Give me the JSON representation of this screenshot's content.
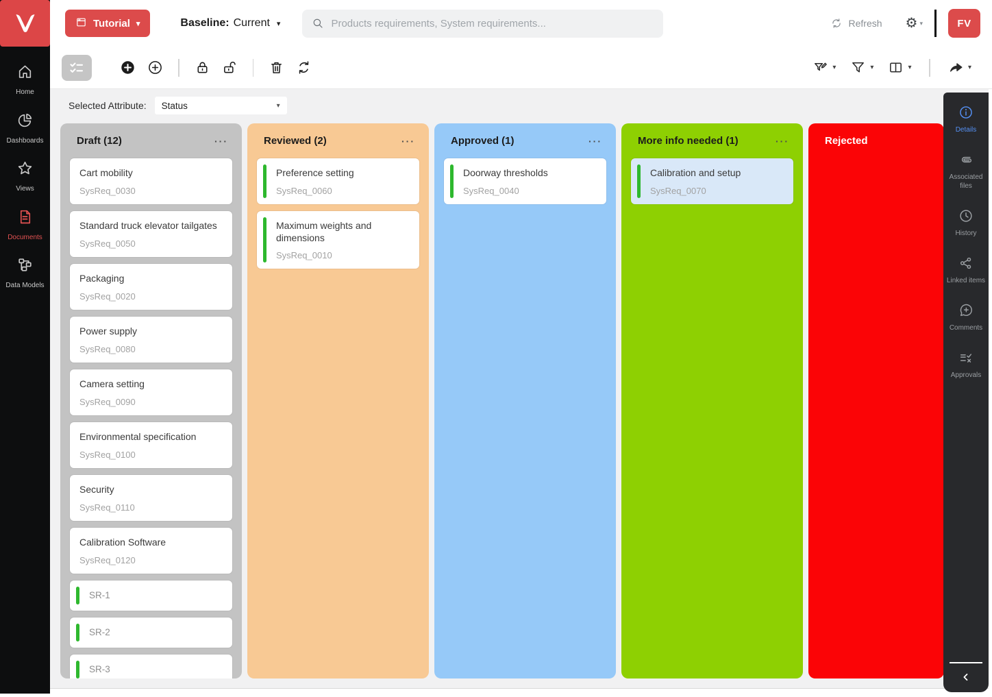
{
  "header": {
    "logo_letter": "V",
    "project_button_label": "Tutorial",
    "baseline_label": "Baseline:",
    "baseline_value": "Current",
    "search_placeholder": "Products requirements, System requirements...",
    "refresh_label": "Refresh",
    "avatar_initials": "FV"
  },
  "left_sidebar": {
    "items": [
      {
        "label": "Home",
        "icon": "home-icon"
      },
      {
        "label": "Dashboards",
        "icon": "dashboards-icon"
      },
      {
        "label": "Views",
        "icon": "views-icon"
      },
      {
        "label": "Documents",
        "icon": "documents-icon",
        "active": true
      },
      {
        "label": "Data Models",
        "icon": "data-models-icon"
      }
    ]
  },
  "toolbar": {
    "left_groups": [
      [
        "add-filled-icon",
        "add-outline-icon"
      ],
      [
        "lock-icon",
        "unlock-icon"
      ],
      [
        "delete-icon",
        "restore-icon"
      ]
    ],
    "right_groups": [
      [
        "filter-edit-icon",
        "filter-icon",
        "columns-icon"
      ],
      [
        "share-icon"
      ]
    ]
  },
  "board": {
    "selected_attribute_label": "Selected Attribute:",
    "selected_attribute_value": "Status",
    "columns": [
      {
        "title": "Draft (12)",
        "color": "#c3c3c3",
        "cards": [
          {
            "title": "Cart mobility",
            "id": "SysReq_0030"
          },
          {
            "title": "Standard truck elevator tailgates",
            "id": "SysReq_0050"
          },
          {
            "title": "Packaging",
            "id": "SysReq_0020"
          },
          {
            "title": "Power supply",
            "id": "SysReq_0080"
          },
          {
            "title": "Camera setting",
            "id": "SysReq_0090"
          },
          {
            "title": "Environmental specification",
            "id": "SysReq_0100"
          },
          {
            "title": "Security",
            "id": "SysReq_0110"
          },
          {
            "title": "Calibration Software",
            "id": "SysReq_0120"
          },
          {
            "title": "SR-1",
            "bar": true,
            "muted": true
          },
          {
            "title": "SR-2",
            "bar": true,
            "muted": true
          },
          {
            "title": "SR-3",
            "bar": true,
            "muted": true
          }
        ]
      },
      {
        "title": "Reviewed (2)",
        "color": "#f8c994",
        "cards": [
          {
            "title": "Preference setting",
            "id": "SysReq_0060",
            "bar": true
          },
          {
            "title": "Maximum weights and dimensions",
            "id": "SysReq_0010",
            "bar": true
          }
        ]
      },
      {
        "title": "Approved (1)",
        "color": "#96c9f8",
        "cards": [
          {
            "title": "Doorway thresholds",
            "id": "SysReq_0040",
            "bar": true
          }
        ]
      },
      {
        "title": "More info needed (1)",
        "color": "#8ed002",
        "cards": [
          {
            "title": "Calibration and setup",
            "id": "SysReq_0070",
            "bar": true,
            "selected": true
          }
        ]
      },
      {
        "title": "Rejected",
        "color": "#fb0406",
        "text_color": "#ffffff",
        "header_only": true,
        "cards": []
      }
    ]
  },
  "right_sidebar": {
    "items": [
      {
        "label": "Details",
        "icon": "info-icon",
        "active": true
      },
      {
        "label": "Associated files",
        "icon": "paperclip-icon"
      },
      {
        "label": "History",
        "icon": "history-icon"
      },
      {
        "label": "Linked items",
        "icon": "linked-items-icon"
      },
      {
        "label": "Comments",
        "icon": "comments-icon"
      },
      {
        "label": "Approvals",
        "icon": "approvals-icon"
      }
    ]
  },
  "colors": {
    "brand_red": "#dc4b4b",
    "active_blue": "#5591f5",
    "green_status_bar": "#2eb82e",
    "selected_card": "#d9e8f8"
  }
}
